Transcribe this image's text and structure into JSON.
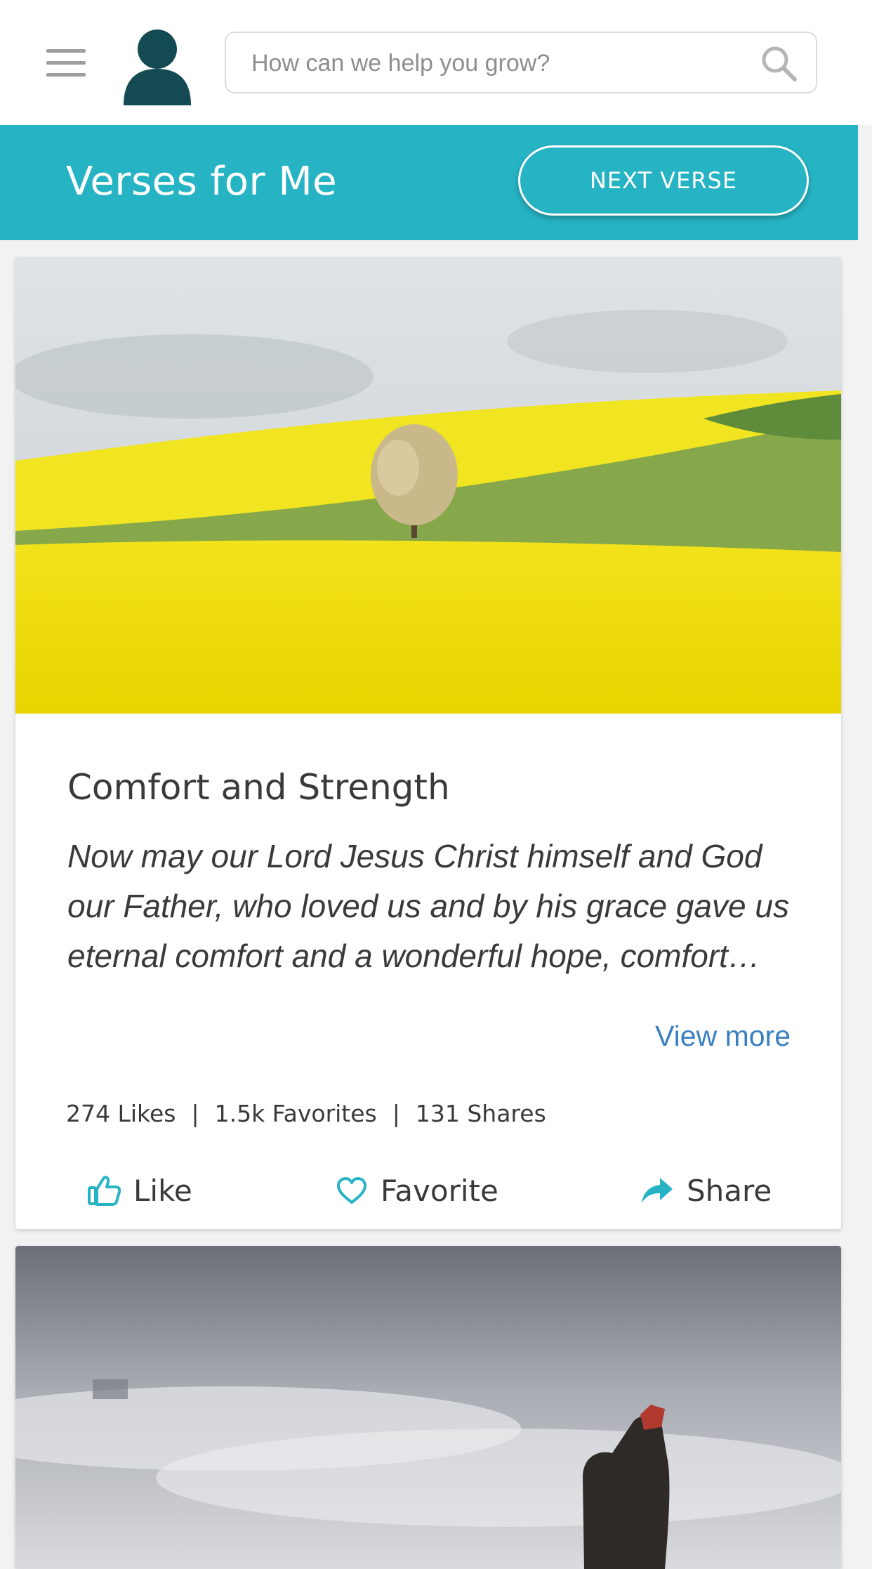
{
  "search": {
    "placeholder": "How can we help you grow?"
  },
  "header": {
    "title": "Verses for Me",
    "next_button": "NEXT VERSE"
  },
  "colors": {
    "accent": "#26b3c4",
    "avatar": "#144a52",
    "link": "#3a80c0"
  },
  "cards": [
    {
      "image": "yellow-field-with-tree",
      "title": "Comfort and Strength",
      "text": "Now may our Lord Jesus Christ himself and God our Father, who loved us and by his grace gave us eternal comfort and a wonderful hope, comfort…",
      "view_more": "View more",
      "stats": {
        "likes": "274 Likes",
        "favorites": "1.5k Favorites",
        "shares": "131 Shares",
        "separator": "|"
      },
      "actions": {
        "like": "Like",
        "favorite": "Favorite",
        "share": "Share"
      }
    },
    {
      "image": "misty-mountain-hiker"
    }
  ]
}
